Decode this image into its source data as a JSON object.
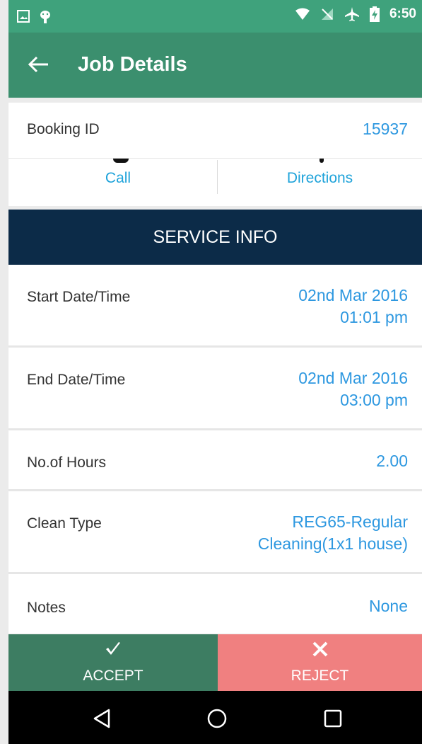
{
  "status_bar": {
    "time": "6:50",
    "icons": [
      "image-icon",
      "android-icon",
      "wifi-icon",
      "no-sim-icon",
      "airplane-icon",
      "battery-charging-icon"
    ]
  },
  "app_bar": {
    "title": "Job Details",
    "back_icon": "arrow-left-icon"
  },
  "booking": {
    "label": "Booking ID",
    "value": "15937"
  },
  "contact_actions": {
    "call": "Call",
    "directions": "Directions"
  },
  "service_info": {
    "header": "SERVICE INFO",
    "rows": [
      {
        "label": "Start Date/Time",
        "value_line1": "02nd Mar 2016",
        "value_line2": "01:01 pm"
      },
      {
        "label": "End Date/Time",
        "value_line1": "02nd Mar 2016",
        "value_line2": "03:00 pm"
      },
      {
        "label": "No.of Hours",
        "value_line1": "2.00"
      },
      {
        "label": "Clean Type",
        "value_line1": "REG65-Regular",
        "value_line2": "Cleaning(1x1 house)"
      },
      {
        "label": "Notes",
        "value_line1": "None"
      }
    ]
  },
  "bottom_actions": {
    "accept": "ACCEPT",
    "reject": "REJECT"
  },
  "colors": {
    "status_bar": "#3fa27c",
    "app_bar": "#3b8f6e",
    "section_header": "#0c2b48",
    "value_blue": "#2e98e0",
    "accept": "#3d7d62",
    "reject": "#f08080"
  },
  "nav_bar": {
    "icons": [
      "back-triangle-icon",
      "home-circle-icon",
      "recents-square-icon"
    ]
  }
}
